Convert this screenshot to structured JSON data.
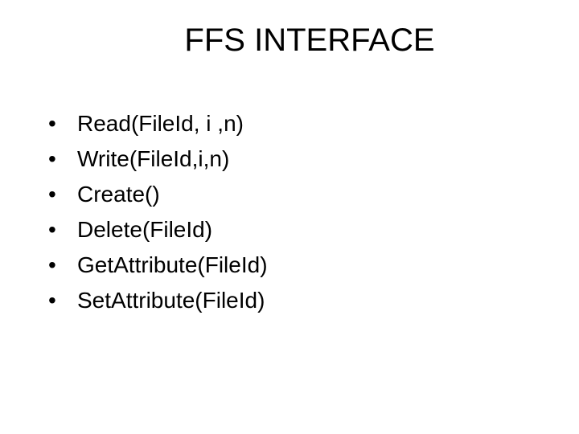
{
  "slide": {
    "title": "FFS INTERFACE",
    "bullets": [
      "Read(FileId, i ,n)",
      "Write(FileId,i,n)",
      "Create()",
      "Delete(FileId)",
      "GetAttribute(FileId)",
      "SetAttribute(FileId)"
    ]
  }
}
